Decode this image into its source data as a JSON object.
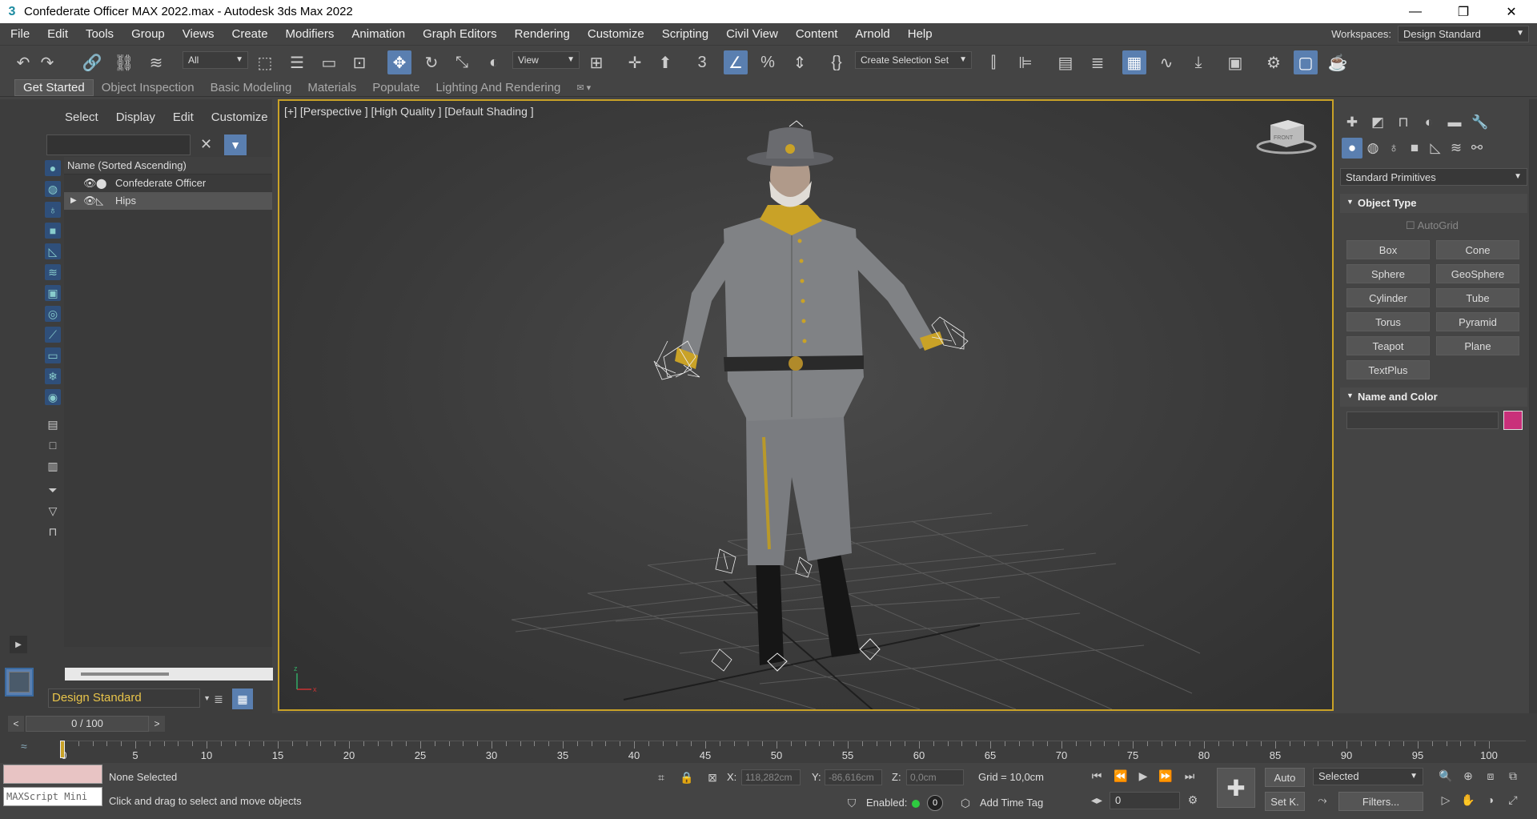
{
  "window": {
    "title": "Confederate Officer MAX 2022.max - Autodesk 3ds Max 2022",
    "minimize": "—",
    "restore": "❐",
    "close": "✕"
  },
  "menu": [
    "File",
    "Edit",
    "Tools",
    "Group",
    "Views",
    "Create",
    "Modifiers",
    "Animation",
    "Graph Editors",
    "Rendering",
    "Customize",
    "Scripting",
    "Civil View",
    "Content",
    "Arnold",
    "Help"
  ],
  "workspaces": {
    "label": "Workspaces:",
    "value": "Design Standard"
  },
  "toolbar": {
    "filter_select": "All",
    "ref_coord": "View",
    "selection_set": "Create Selection Set"
  },
  "ribbon_tabs": [
    "Get Started",
    "Object Inspection",
    "Basic Modeling",
    "Materials",
    "Populate",
    "Lighting And Rendering"
  ],
  "explorer": {
    "tabs": [
      "Select",
      "Display",
      "Edit",
      "Customize"
    ],
    "column_header": "Name (Sorted Ascending)",
    "items": [
      {
        "name": "Confederate Officer",
        "type": "geometry"
      },
      {
        "name": "Hips",
        "type": "bone"
      }
    ],
    "layer": "Design Standard"
  },
  "viewport": {
    "label": "[+] [Perspective ] [High Quality ] [Default Shading ]",
    "viewcube": "FRONT"
  },
  "command_panel": {
    "category": "Standard Primitives",
    "object_type": {
      "title": "Object Type",
      "autogrid": "AutoGrid",
      "buttons": [
        "Box",
        "Cone",
        "Sphere",
        "GeoSphere",
        "Cylinder",
        "Tube",
        "Torus",
        "Pyramid",
        "Teapot",
        "Plane",
        "TextPlus"
      ]
    },
    "name_color": {
      "title": "Name and Color",
      "color": "#c9307a"
    }
  },
  "timeline": {
    "frame": "0 / 100",
    "ticks": [
      "0",
      "5",
      "10",
      "15",
      "20",
      "25",
      "30",
      "35",
      "40",
      "45",
      "50",
      "55",
      "60",
      "65",
      "70",
      "75",
      "80",
      "85",
      "90",
      "95",
      "100"
    ]
  },
  "status": {
    "maxscript": "MAXScript Mini",
    "selection": "None Selected",
    "prompt": "Click and drag to select and move objects",
    "x_label": "X:",
    "x": "118,282cm",
    "y_label": "Y:",
    "y": "-86,616cm",
    "z_label": "Z:",
    "z": "0,0cm",
    "grid": "Grid = 10,0cm",
    "enabled": "Enabled:",
    "enabled_value": "0",
    "add_time_tag": "Add Time Tag",
    "auto": "Auto",
    "set_key": "Set K.",
    "key_filter": "Selected",
    "filters": "Filters...",
    "current_frame": "0"
  }
}
